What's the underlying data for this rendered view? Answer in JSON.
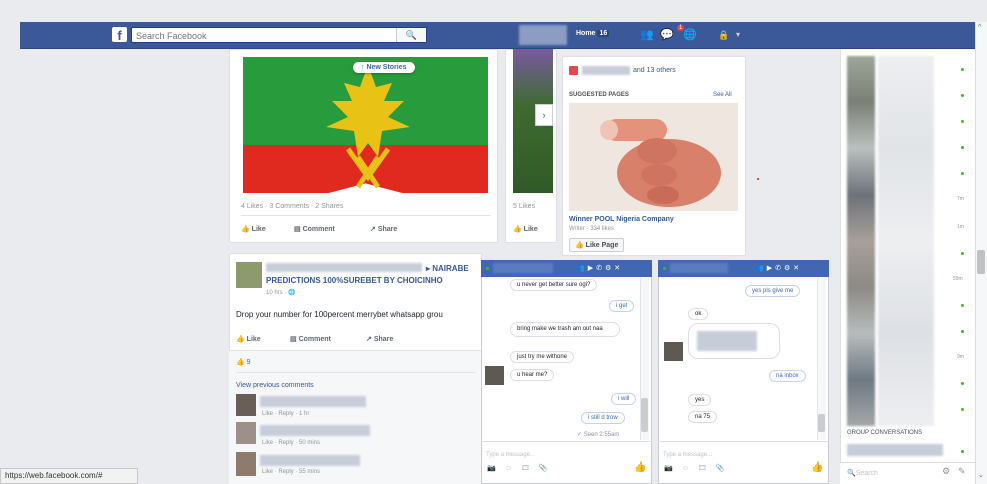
{
  "header": {
    "logo": "f",
    "search_placeholder": "Search Facebook",
    "search_button": "🔍",
    "home_label": "Home",
    "home_count": "16",
    "notif_badge": "1",
    "account_caret": "▾"
  },
  "colors": {
    "fb_blue": "#3b5998",
    "accent": "#4267b2",
    "online": "#42b72a"
  },
  "story_card": {
    "new_stories": "↑ New Stories",
    "stats": "4 Likes · 3 Comments · 2 Shares",
    "like": "Like",
    "comment": "Comment",
    "share": "Share"
  },
  "second_card": {
    "stats": "5 Likes",
    "like": "Like",
    "next": "›"
  },
  "right_card": {
    "others": "and 13 others",
    "suggested_title": "SUGGESTED PAGES",
    "see_all": "See All",
    "page_name": "Winner POOL Nigeria Company",
    "page_meta": "Writer · 334 likes",
    "like_page": "Like Page"
  },
  "post": {
    "group": "NAIRABE",
    "title": "PREDICTIONS 100%SUREBET BY CHOICINHO",
    "time": "10 hrs · ",
    "body": "Drop your number for 100percent merrybet whatsapp grou",
    "like": "Like",
    "comment": "Comment",
    "share": "Share",
    "reactions": "9",
    "view_previous": "View previous comments",
    "comments": [
      {
        "meta": "Like · Reply · 1 hr"
      },
      {
        "meta": "Like · Reply · 50 mins"
      },
      {
        "meta": "Like · Reply · 55 mins"
      }
    ]
  },
  "chat1": {
    "messages": [
      {
        "from": "them",
        "text": "u never get better sure ogi?"
      },
      {
        "from": "me",
        "text": "i get"
      },
      {
        "from": "them",
        "text": "bring make we trash am out naa"
      },
      {
        "from": "them",
        "text": "just try me withone"
      },
      {
        "from": "them",
        "text": "u hear me?"
      },
      {
        "from": "me",
        "text": "i will"
      },
      {
        "from": "me",
        "text": "i still d trow"
      }
    ],
    "seen": "✓ Seen 2:55am",
    "input_placeholder": "Type a message..."
  },
  "chat2": {
    "messages": [
      {
        "from": "me",
        "text": "yes pls give me"
      },
      {
        "from": "them",
        "text": "ok"
      },
      {
        "from": "me",
        "text": "na inbox"
      },
      {
        "from": "them",
        "text": "yes"
      },
      {
        "from": "them",
        "text": "na 75"
      }
    ],
    "input_placeholder": "Type a message..."
  },
  "chat_sidebar": {
    "times": [
      "7m",
      "1m",
      "59m",
      "9m"
    ],
    "group_conversations": "GROUP CONVERSATIONS",
    "search_placeholder": "Search"
  },
  "status_bar": {
    "url": "https://web.facebook.com/#"
  }
}
